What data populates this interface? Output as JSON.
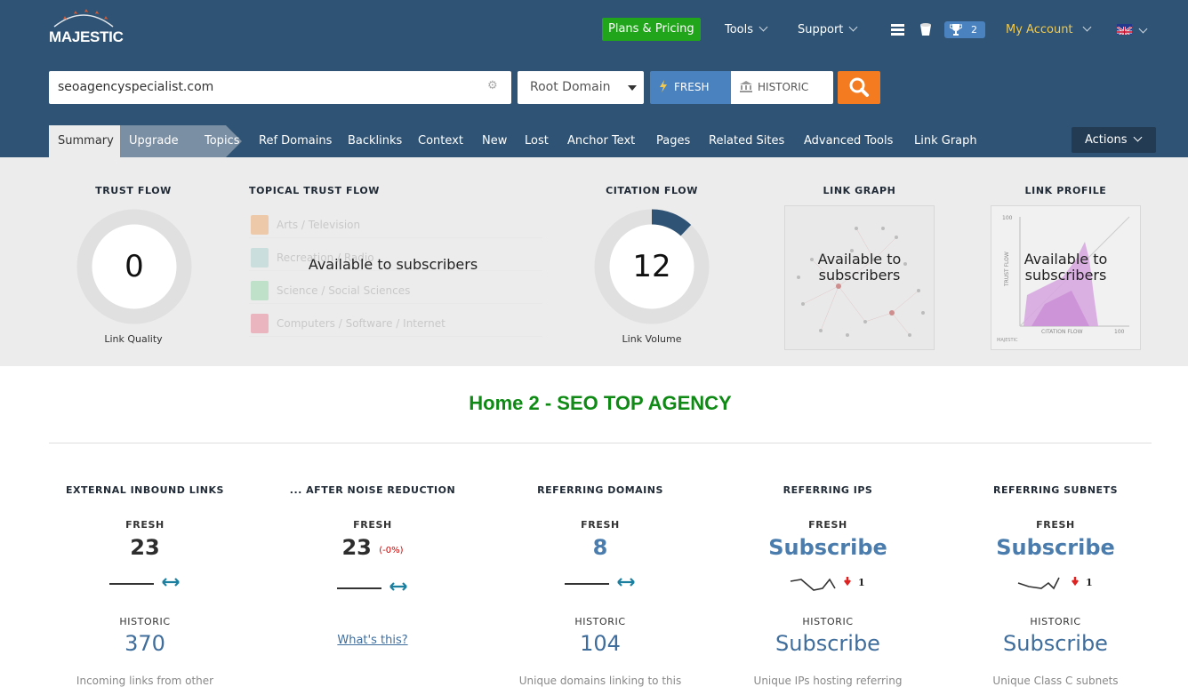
{
  "header": {
    "logo_text": "MAJESTIC",
    "plans_label": "Plans & Pricing",
    "tools_label": "Tools",
    "support_label": "Support",
    "trophy_count": "2",
    "account_label": "My Account"
  },
  "search": {
    "value": "seoagencyspecialist.com",
    "scope": "Root Domain",
    "fresh_label": "FRESH",
    "historic_label": "HISTORIC"
  },
  "tabs": {
    "summary": "Summary",
    "upgrade": "Upgrade",
    "topics": "Topics",
    "ref_domains": "Ref Domains",
    "backlinks": "Backlinks",
    "context": "Context",
    "new": "New",
    "lost": "Lost",
    "anchor_text": "Anchor Text",
    "pages": "Pages",
    "related_sites": "Related Sites",
    "advanced_tools": "Advanced Tools",
    "link_graph": "Link Graph",
    "actions": "Actions"
  },
  "metrics": {
    "trust_flow": {
      "title": "TRUST FLOW",
      "value": "0",
      "caption": "Link Quality"
    },
    "topical": {
      "title": "TOPICAL TRUST FLOW",
      "rows": [
        "Arts / Television",
        "Recreation / Radio",
        "Science / Social Sciences",
        "Computers / Software / Internet"
      ],
      "overlay": "Available to subscribers"
    },
    "citation_flow": {
      "title": "CITATION FLOW",
      "value": "12",
      "caption": "Link Volume",
      "fraction": 0.12
    },
    "link_graph": {
      "title": "LINK GRAPH",
      "overlay_1": "Available to",
      "overlay_2": "subscribers"
    },
    "link_profile": {
      "title": "LINK PROFILE",
      "overlay_1": "Available to",
      "overlay_2": "subscribers",
      "y_axis": "TRUST FLOW",
      "x_axis": "CITATION FLOW",
      "tick_100": "100",
      "brand": "MAJESTIC"
    }
  },
  "site_title": "Home 2 - SEO TOP AGENCY",
  "stats": {
    "fresh_label": "FRESH",
    "historic_label": "HISTORIC",
    "external": {
      "title": "EXTERNAL INBOUND LINKS",
      "fresh": "23",
      "historic": "370",
      "desc": "Incoming links from other"
    },
    "noise": {
      "title": "... AFTER NOISE REDUCTION",
      "fresh": "23",
      "pct": "(-0%)",
      "whats": "What's this?"
    },
    "domains": {
      "title": "REFERRING DOMAINS",
      "fresh": "8",
      "historic": "104",
      "desc": "Unique domains linking to this"
    },
    "ips": {
      "title": "REFERRING IPS",
      "fresh": "Subscribe",
      "delta": "1",
      "historic": "Subscribe",
      "desc": "Unique IPs hosting referring"
    },
    "subnets": {
      "title": "REFERRING SUBNETS",
      "fresh": "Subscribe",
      "delta": "1",
      "historic": "Subscribe",
      "desc": "Unique Class C subnets"
    }
  },
  "colors": {
    "header_bg": "#2f5374",
    "plans_bg": "#21a51b",
    "search_accent": "#f47b20",
    "fresh_bg": "#4a81bf",
    "citation_arc": "#2f5374",
    "title_green": "#0f8a15"
  }
}
